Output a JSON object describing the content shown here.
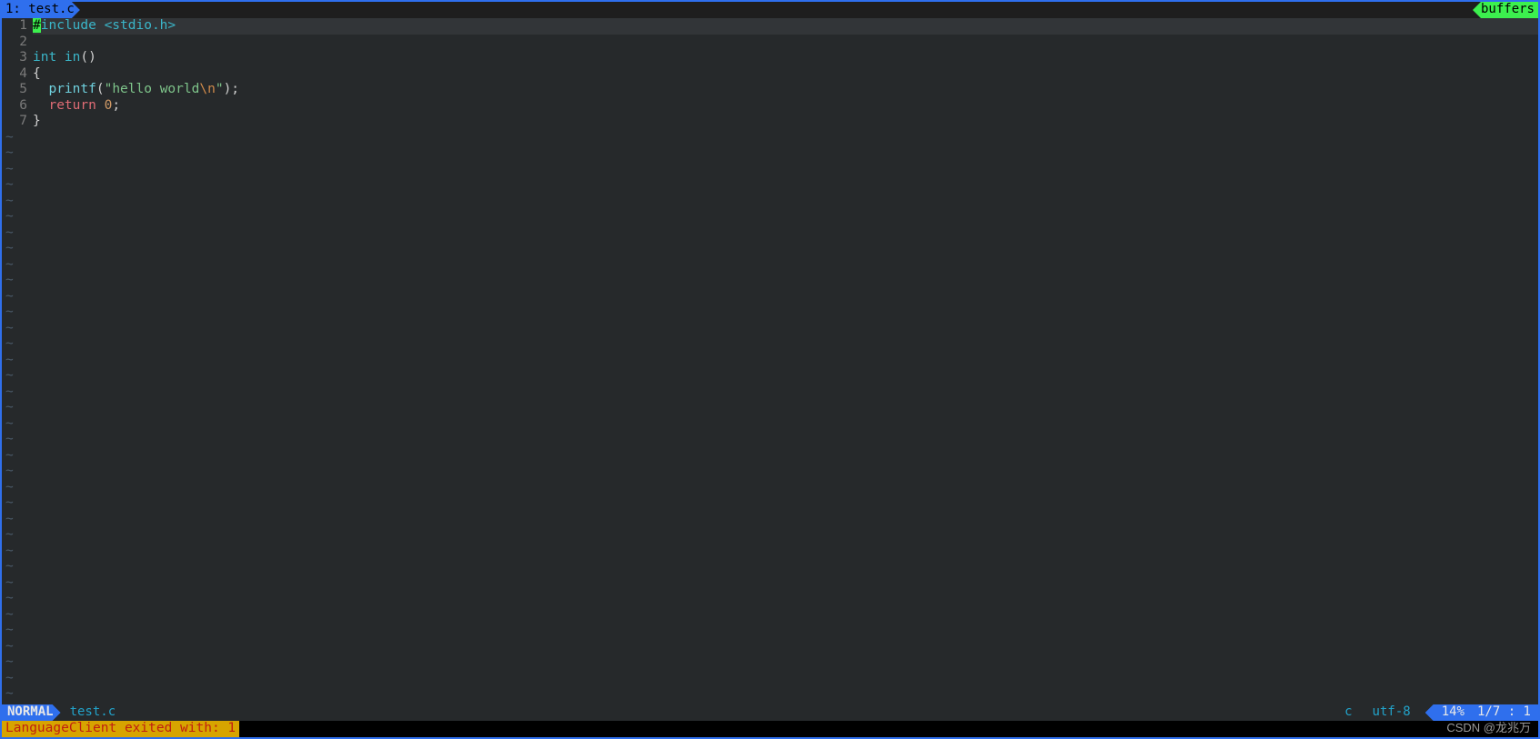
{
  "tab": {
    "label": "1: test.c"
  },
  "buffers_label": "buffers",
  "gutter": [
    "1",
    "2",
    "3",
    "4",
    "5",
    "6",
    "7"
  ],
  "code": {
    "l1": {
      "hash": "#",
      "include": "include ",
      "hdr": "<stdio.h>"
    },
    "l3": {
      "kw": "int ",
      "fn": "in",
      "paren": "()"
    },
    "l4": "{",
    "l5": {
      "indent": "  ",
      "call": "printf",
      "open": "(",
      "q1": "\"",
      "s": "hello world",
      "esc": "\\n",
      "q2": "\"",
      "close": ");"
    },
    "l6": {
      "indent": "  ",
      "ret": "return ",
      "num": "0",
      "semi": ";"
    },
    "l7": "}"
  },
  "tilde": "~",
  "status": {
    "mode": "NORMAL",
    "file": "test.c",
    "filetype": "c",
    "encoding": "utf-8",
    "percent": "14%",
    "linecol": "1/7 :  1"
  },
  "message": "LanguageClient exited with: 1",
  "watermark": "CSDN @龙兆万"
}
